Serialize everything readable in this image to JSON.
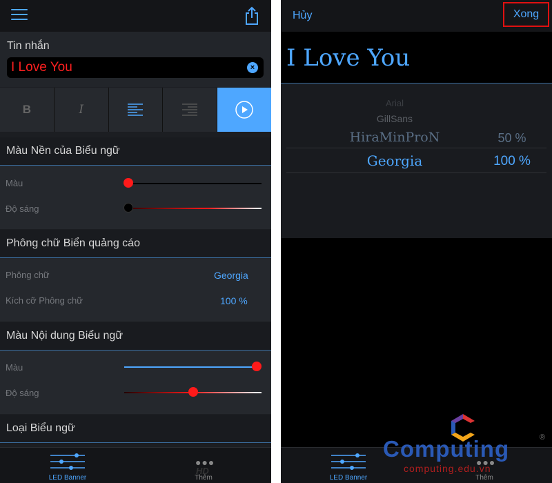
{
  "left": {
    "message_label": "Tin nhắn",
    "message_value": "I Love You",
    "format_buttons": {
      "bold": "B",
      "italic": "I"
    },
    "bg_section": {
      "title": "Màu Nền của Biểu ngữ",
      "color_label": "Màu",
      "brightness_label": "Độ sáng",
      "color_level": 0.0,
      "brightness_level": 0.0
    },
    "font_section": {
      "title": "Phông chữ Biển quảng cáo",
      "font_label": "Phông chữ",
      "font_value": "Georgia",
      "size_label": "Kích cỡ Phông chữ",
      "size_value": "100 %"
    },
    "content_section": {
      "title": "Màu Nội dung Biểu ngữ",
      "color_label": "Màu",
      "brightness_label": "Độ sáng",
      "color_level": 1.0,
      "brightness_level": 0.5
    },
    "type_section": {
      "title": "Loại Biểu ngữ"
    },
    "tabs": {
      "led": "LED Banner",
      "more": "Thêm",
      "hd_badge": "HD"
    }
  },
  "right": {
    "cancel": "Hủy",
    "done": "Xong",
    "preview_text": "I Love You",
    "picker_fonts": [
      "Arial",
      "GillSans",
      "HiraMinProN",
      "Georgia"
    ],
    "picker_sizes": [
      "50 %",
      "100 %"
    ],
    "tabs": {
      "led": "LED Banner",
      "more": "Thêm"
    }
  },
  "watermark": {
    "brand": "Computing",
    "site": "computing.edu.vn",
    "registered": "®"
  },
  "colors": {
    "accent": "#4ea7ff",
    "red": "#ff1a1a",
    "highlight": "#e01010"
  }
}
